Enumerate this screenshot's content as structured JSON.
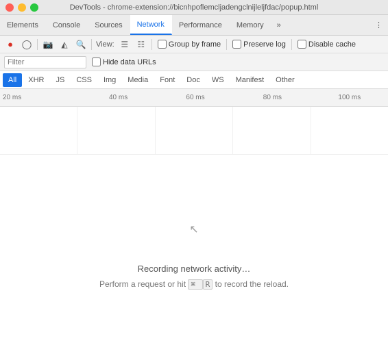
{
  "titleBar": {
    "title": "DevTools - chrome-extension://bicnhpoflemcljadengclnijleljfdac/popup.html"
  },
  "tabs": [
    {
      "id": "elements",
      "label": "Elements",
      "active": false
    },
    {
      "id": "console",
      "label": "Console",
      "active": false
    },
    {
      "id": "sources",
      "label": "Sources",
      "active": false
    },
    {
      "id": "network",
      "label": "Network",
      "active": true
    },
    {
      "id": "performance",
      "label": "Performance",
      "active": false
    },
    {
      "id": "memory",
      "label": "Memory",
      "active": false
    }
  ],
  "toolbar": {
    "viewLabel": "View:",
    "groupByFrame": "Group by frame",
    "preserveLog": "Preserve log",
    "disableCache": "Disable cache"
  },
  "filterBar": {
    "filterPlaceholder": "Filter",
    "hideDataURLs": "Hide data URLs"
  },
  "typeFilters": [
    {
      "id": "all",
      "label": "All",
      "active": true
    },
    {
      "id": "xhr",
      "label": "XHR",
      "active": false
    },
    {
      "id": "js",
      "label": "JS",
      "active": false
    },
    {
      "id": "css",
      "label": "CSS",
      "active": false
    },
    {
      "id": "img",
      "label": "Img",
      "active": false
    },
    {
      "id": "media",
      "label": "Media",
      "active": false
    },
    {
      "id": "font",
      "label": "Font",
      "active": false
    },
    {
      "id": "doc",
      "label": "Doc",
      "active": false
    },
    {
      "id": "ws",
      "label": "WS",
      "active": false
    },
    {
      "id": "manifest",
      "label": "Manifest",
      "active": false
    },
    {
      "id": "other",
      "label": "Other",
      "active": false
    }
  ],
  "timeline": {
    "labels": [
      "20 ms",
      "40 ms",
      "60 ms",
      "80 ms",
      "100 ms"
    ]
  },
  "mainContent": {
    "recordingText": "Recording network activity…",
    "hintText": "Perform a request or hit",
    "shortcutSymbol": "⌘",
    "shortcutKey": "R",
    "hintSuffix": "to record the reload."
  }
}
